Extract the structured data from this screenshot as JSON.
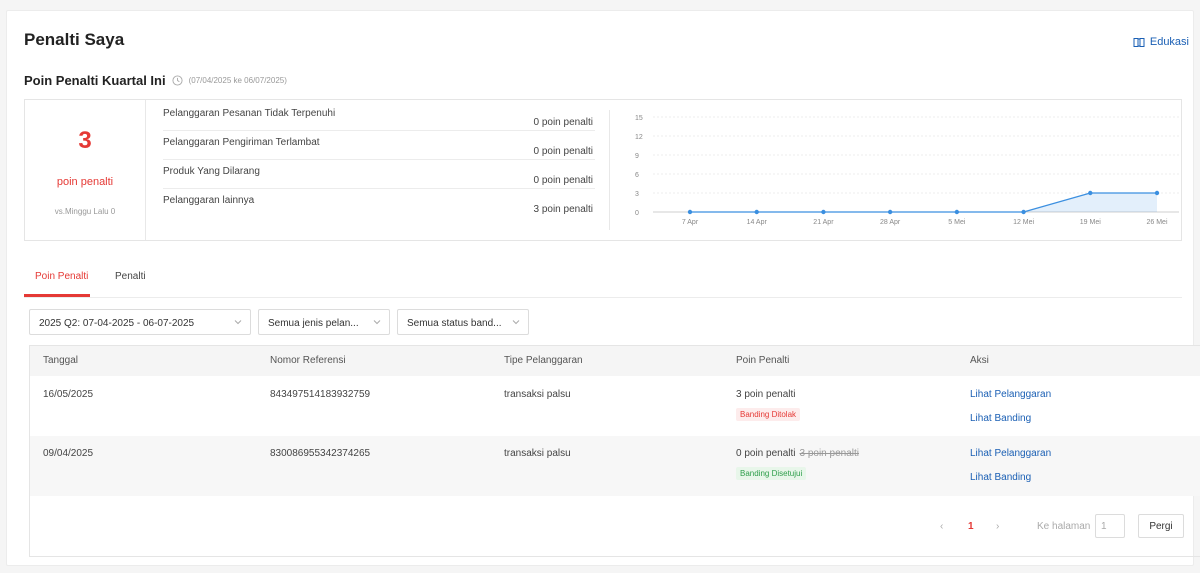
{
  "header": {
    "title": "Penalti Saya",
    "education_link": "Edukasi",
    "education_icon": "book-icon"
  },
  "quarter": {
    "title": "Poin Penalti Kuartal Ini",
    "clock_icon": "clock-icon",
    "date_range": "(07/04/2025 ke 06/07/2025)"
  },
  "summary": {
    "points": "3",
    "points_label": "poin penalti",
    "comparison": "vs.Minggu Lalu 0",
    "accent_color": "#e53935",
    "breakdown": [
      {
        "label": "Pelanggaran Pesanan Tidak Terpenuhi",
        "value": "0 poin penalti"
      },
      {
        "label": "Pelanggaran Pengiriman Terlambat",
        "value": "0 poin penalti"
      },
      {
        "label": "Produk Yang Dilarang",
        "value": "0 poin penalti"
      },
      {
        "label": "Pelanggaran lainnya",
        "value": "3 poin penalti"
      }
    ]
  },
  "chart_data": {
    "type": "area",
    "categories": [
      "7 Apr",
      "14 Apr",
      "21 Apr",
      "28 Apr",
      "5 Mei",
      "12 Mei",
      "19 Mei",
      "26 Mei"
    ],
    "series": [
      {
        "values": [
          0,
          0,
          0,
          0,
          0,
          0,
          3,
          3
        ],
        "color": "#3b8fe0"
      }
    ],
    "ylim": [
      0,
      15
    ],
    "yticks": [
      "0",
      "3",
      "6",
      "9",
      "12",
      "15"
    ],
    "grid": true
  },
  "tabs": [
    {
      "label": "Poin Penalti",
      "active": true
    },
    {
      "label": "Penalti",
      "active": false
    }
  ],
  "filters": [
    {
      "value": "2025 Q2: 07-04-2025 - 06-07-2025",
      "icon": "chevron-down-icon"
    },
    {
      "value": "Semua jenis pelan...",
      "icon": "chevron-down-icon"
    },
    {
      "value": "Semua status band...",
      "icon": "chevron-down-icon"
    }
  ],
  "table": {
    "headers": [
      "Tanggal",
      "Nomor Referensi",
      "Tipe Pelanggaran",
      "Poin Penalti",
      "Aksi"
    ],
    "rows": [
      {
        "date": "16/05/2025",
        "reference": "843497514183932759",
        "type": "transaksi palsu",
        "points": "3 poin penalti",
        "points_struck": "",
        "status": "Banding Ditolak",
        "status_color": "red",
        "action1": "Lihat Pelanggaran",
        "action2": "Lihat Banding"
      },
      {
        "date": "09/04/2025",
        "reference": "830086955342374265",
        "type": "transaksi palsu",
        "points": "0 poin penalti",
        "points_struck": "3 poin penalti",
        "status": "Banding Disetujui",
        "status_color": "green",
        "action1": "Lihat Pelanggaran",
        "action2": "Lihat Banding"
      }
    ]
  },
  "pagination": {
    "prev": "‹",
    "current": "1",
    "next": "›",
    "goto_label": "Ke halaman",
    "goto_value": "1",
    "go_button": "Pergi"
  }
}
